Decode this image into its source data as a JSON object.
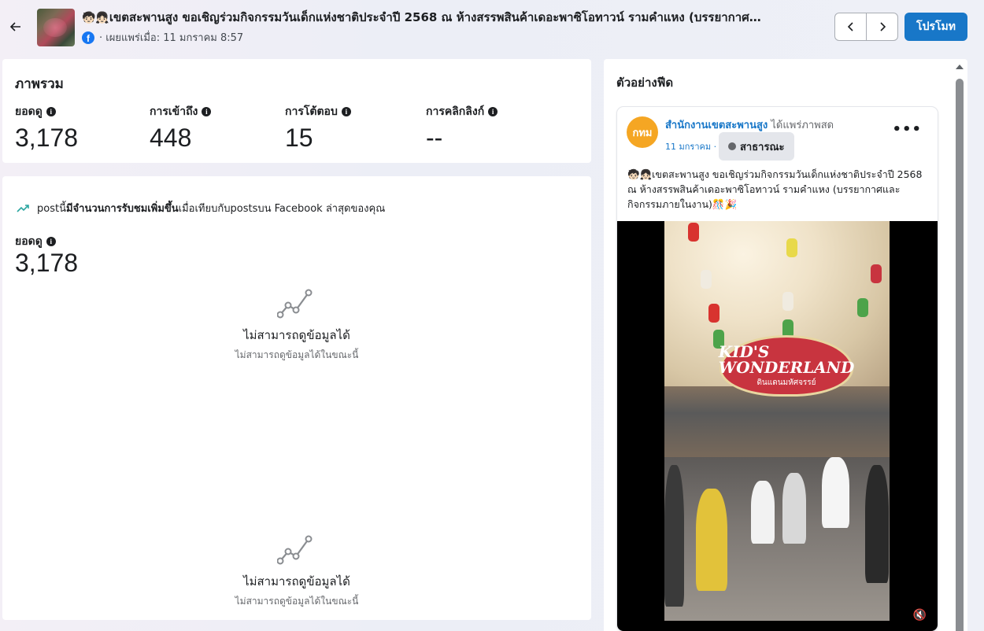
{
  "header": {
    "back_label": "←",
    "title_emoji": "🧒🏻👧🏻",
    "title": "เขตสะพานสูง ขอเชิญร่วมกิจกรรมวันเด็กแห่งชาติประจำปี 2568 ณ ห้างสรรพสินค้าเดอะพาซิโอทาวน์ รามคำแหง (บรรยากาศ…",
    "published": "· เผยแพร่เมื่อ: 11 มกราคม 8:57",
    "prev_icon": "‹",
    "next_icon": "›",
    "promote_label": "โปรโมท"
  },
  "overview": {
    "title": "ภาพรวม",
    "stats": [
      {
        "label": "ยอดดู",
        "value": "3,178"
      },
      {
        "label": "การเข้าถึง",
        "value": "448"
      },
      {
        "label": "การโต้ตอบ",
        "value": "15"
      },
      {
        "label": "การคลิกลิงก์",
        "value": "--"
      }
    ]
  },
  "views_card": {
    "trend_prefix": "postนี้",
    "trend_bold": "มีจำนวนการรับชมเพิ่มขึ้น",
    "trend_suffix": "เมื่อเทียบกับpostsบน Facebook ล่าสุดของคุณ",
    "views_label": "ยอดดู",
    "views_value": "3,178",
    "empty_title": "ไม่สามารถดูข้อมูลได้",
    "empty_subtitle": "ไม่สามารถดูข้อมูลได้ในขณะนี้"
  },
  "feed": {
    "title": "ตัวอย่างฟีด",
    "post": {
      "avatar_text": "กทม",
      "page_name": "สำนักงานเขตสะพานสูง",
      "action": " ได้แพร่ภาพสด",
      "date": "11 มกราคม ·",
      "audience": "สาธารณะ",
      "more": "•••",
      "text": "🧒🏻👧🏻เขตสะพานสูง ขอเชิญร่วมกิจกรรมวันเด็กแห่งชาติประจำปี 2568 ณ ห้างสรรพสินค้าเดอะพาซิโอทาวน์ รามคำแหง (บรรยากาศและกิจกรรมภายในงาน)🎊🎉",
      "sign_title": "KID'S WONDERLAND",
      "sign_sub": "ดินแดนมหัศจรรย์",
      "mute_icon": "🔇"
    }
  }
}
